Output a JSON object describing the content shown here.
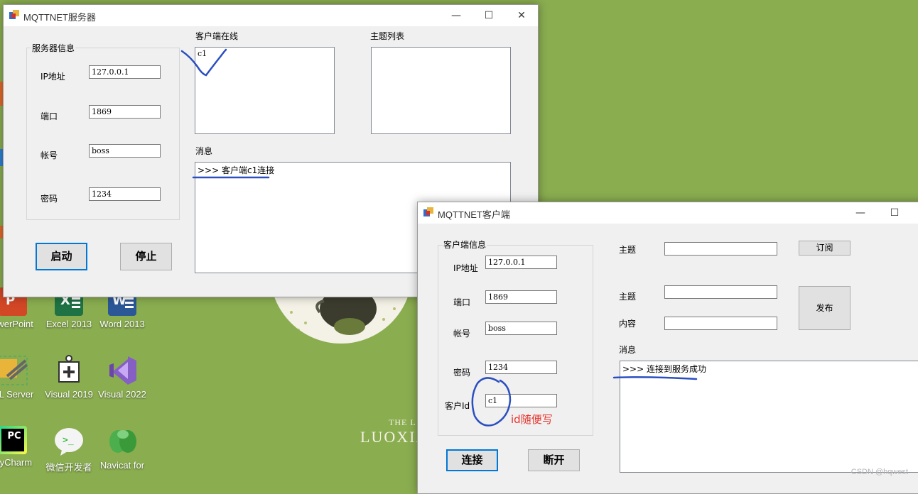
{
  "desktop": {
    "icons": [
      {
        "label": "owerPoint"
      },
      {
        "label": "Excel 2013"
      },
      {
        "label": "Word 2013"
      },
      {
        "label": "QL Server"
      },
      {
        "label": "Visual 2019"
      },
      {
        "label": "Visual 2022"
      },
      {
        "label": "PyCharm"
      },
      {
        "label": "微信开发者"
      },
      {
        "label": "Navicat for"
      }
    ],
    "wallpaper_small": "THE L",
    "wallpaper_big": "LUOXIA"
  },
  "server_window": {
    "title": "MQTTNET服务器",
    "group_title": "服务器信息",
    "ip_label": "IP地址",
    "ip_value": "127.0.0.1",
    "port_label": "端口",
    "port_value": "1869",
    "account_label": "帐号",
    "account_value": "boss",
    "password_label": "密码",
    "password_value": "1234",
    "start_button": "启动",
    "stop_button": "停止",
    "clients_label": "客户端在线",
    "clients": [
      "c1"
    ],
    "topics_label": "主题列表",
    "messages_label": "消息",
    "messages": [
      ">>> 客户端c1连接"
    ]
  },
  "client_window": {
    "title": "MQTTNET客户端",
    "group_title": "客户端信息",
    "ip_label": "IP地址",
    "ip_value": "127.0.0.1",
    "port_label": "端口",
    "port_value": "1869",
    "account_label": "帐号",
    "account_value": "boss",
    "password_label": "密码",
    "password_value": "1234",
    "client_id_label": "客户Id",
    "client_id_value": "c1",
    "connect_button": "连接",
    "disconnect_button": "断开",
    "subscribe_topic_label": "主题",
    "subscribe_button": "订阅",
    "publish_topic_label": "主题",
    "content_label": "内容",
    "publish_button": "发布",
    "messages_label": "消息",
    "messages": [
      ">>> 连接到服务成功"
    ],
    "annotation": "id随便写"
  },
  "watermark": "CSDN @hqwest",
  "colors": {
    "desktop_bg": "#8aad50",
    "annotation_ink": "#2b4fbf",
    "annotation_note": "#e8322c",
    "default_button_border": "#0078d7"
  }
}
